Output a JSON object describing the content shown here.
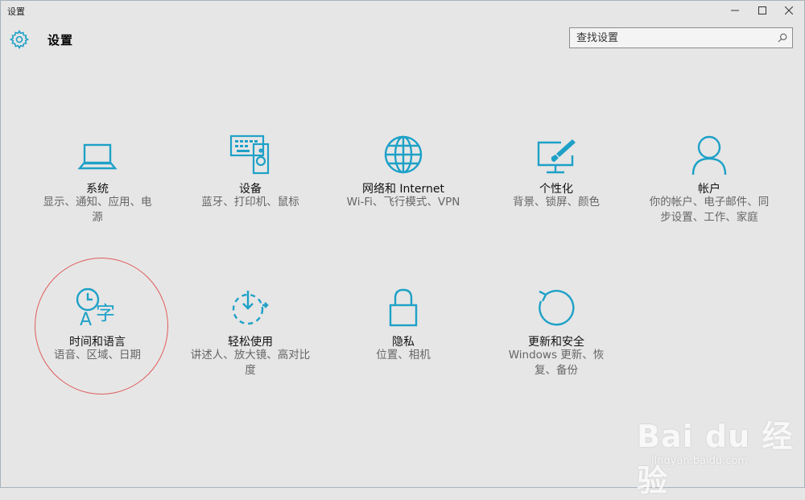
{
  "window": {
    "title": "设置"
  },
  "header": {
    "title": "设置"
  },
  "search": {
    "placeholder": "查找设置"
  },
  "colors": {
    "accent": "#1ea1c7",
    "highlight": "#e05c5c"
  },
  "tiles": [
    {
      "label": "系统",
      "desc": "显示、通知、应用、电源",
      "icon": "laptop-icon"
    },
    {
      "label": "设备",
      "desc": "蓝牙、打印机、鼠标",
      "icon": "keyboard-speaker-icon"
    },
    {
      "label": "网络和 Internet",
      "desc": "Wi-Fi、飞行模式、VPN",
      "icon": "globe-icon"
    },
    {
      "label": "个性化",
      "desc": "背景、锁屏、颜色",
      "icon": "monitor-brush-icon"
    },
    {
      "label": "帐户",
      "desc": "你的帐户、电子邮件、同步设置、工作、家庭",
      "icon": "person-icon"
    },
    {
      "label": "时间和语言",
      "desc": "语音、区域、日期",
      "icon": "time-language-icon"
    },
    {
      "label": "轻松使用",
      "desc": "讲述人、放大镜、高对比度",
      "icon": "ease-of-access-icon"
    },
    {
      "label": "隐私",
      "desc": "位置、相机",
      "icon": "lock-icon"
    },
    {
      "label": "更新和安全",
      "desc": "Windows 更新、恢复、备份",
      "icon": "refresh-icon"
    }
  ],
  "watermark": {
    "brand": "Bai du 经验",
    "url": "jingyan.baidu.com"
  }
}
